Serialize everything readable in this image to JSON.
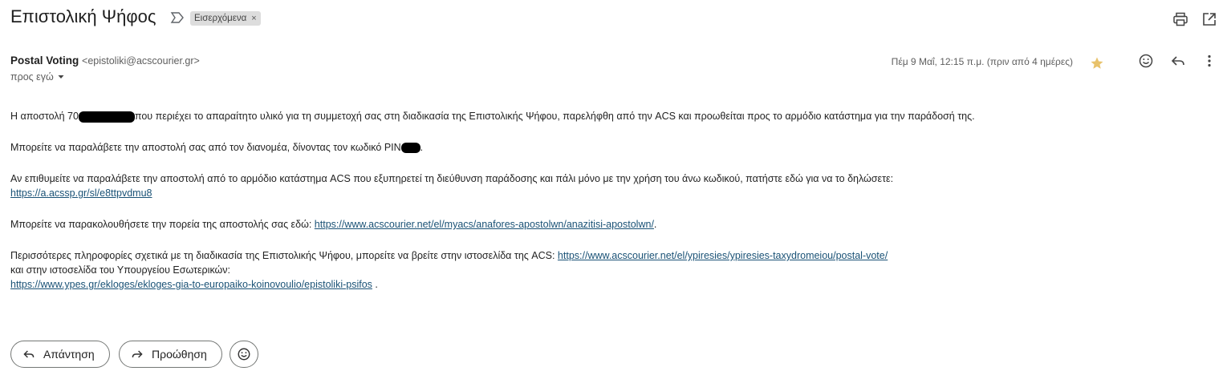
{
  "header": {
    "subject": "Επιστολική Ψήφος",
    "label_chip": "Εισερχόμενα",
    "chip_close": "×"
  },
  "sender": {
    "name": "Postal Voting",
    "email": "<epistoliki@acscourier.gr>",
    "to_me": "προς εγώ",
    "date": "Πέμ 9 Μαΐ, 12:15 π.μ. (πριν από 4 ημέρες)"
  },
  "message": {
    "p1_before": "Η αποστολή 70",
    "p1_after": "που περιέχει το απαραίτητο υλικό για τη συμμετοχή σας στη διαδικασία της Επιστολικής Ψήφου, παρελήφθη από την ACS και προωθείται προς το αρμόδιο κατάστημα για την παράδοσή της.",
    "p2_before": "Μπορείτε να παραλάβετε την αποστολή σας από τον διανομέα, δίνοντας τον κωδικό PIN",
    "p2_after": ".",
    "p3_text": "Αν επιθυμείτε να παραλάβετε την αποστολή από το αρμόδιο κατάστημα ACS που εξυπηρετεί τη διεύθυνση παράδοσης και πάλι μόνο με την χρήση του άνω κωδικού, πατήστε εδώ για να το δηλώσετε:",
    "p3_link": "https://a.acssp.gr/sl/e8ttpvdmu8",
    "p4_text": "Μπορείτε να παρακολουθήσετε την πορεία της αποστολής σας εδώ: ",
    "p4_link": "https://www.acscourier.net/el/myacs/anafores-apostolwn/anazitisi-apostolwn/",
    "p4_after": ".",
    "p5_text": "Περισσότερες πληροφορίες σχετικά με τη διαδικασία της Επιστολικής Ψήφου, μπορείτε να βρείτε στην ιστοσελίδα της ACS: ",
    "p5_link1": "https://www.acscourier.net/el/ypiresies/ypiresies-taxydromeiou/postal-vote/",
    "p5_line2": "και στην ιστοσελίδα του Υπουργείου Εσωτερικών:",
    "p5_link2": "https://www.ypes.gr/ekloges/ekloges-gia-to-europaiko-koinovoulio/epistoliki-psifos",
    "p5_after": " ."
  },
  "actions": {
    "reply": "Απάντηση",
    "forward": "Προώθηση"
  },
  "colors": {
    "link": "#1a5276",
    "star": "#e8c26b",
    "chip_bg": "#dddddd"
  },
  "icons": [
    "important-marker-icon",
    "print-icon",
    "open-new-window-icon",
    "star-icon",
    "emoji-icon",
    "reply-icon",
    "more-vert-icon",
    "caret-down-icon",
    "forward-icon"
  ]
}
